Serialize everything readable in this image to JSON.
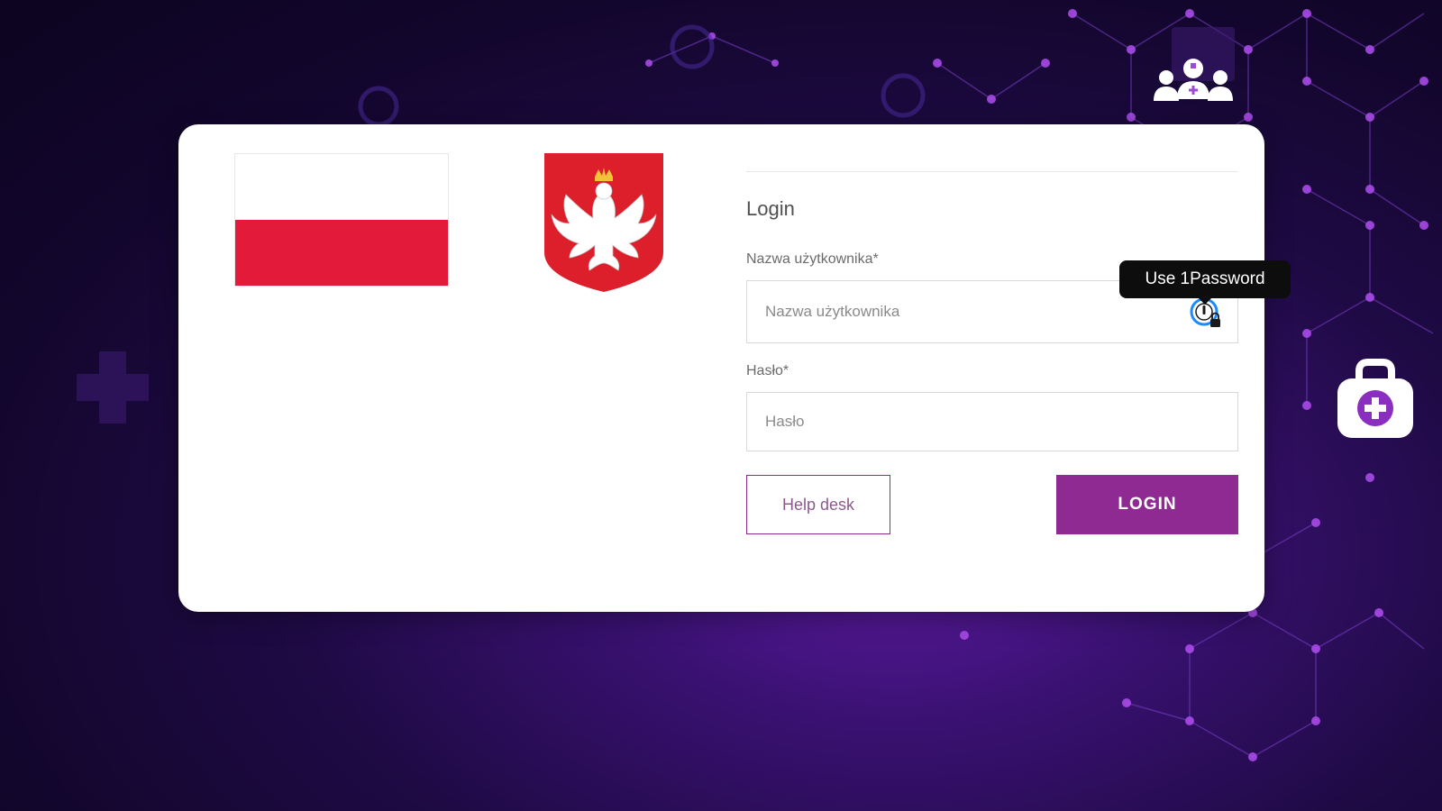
{
  "login": {
    "title": "Login",
    "username_label": "Nazwa użytkownika*",
    "username_placeholder": "Nazwa użytkownika",
    "password_label": "Hasło*",
    "password_placeholder": "Hasło",
    "helpdesk_label": "Help desk",
    "login_label": "LOGIN"
  },
  "tooltip": {
    "text": "Use 1Password"
  },
  "icons": {
    "flag": "poland-flag-icon",
    "emblem": "polish-eagle-emblem-icon",
    "password_manager": "1password-icon",
    "team": "medical-team-icon",
    "medkit": "medical-kit-icon"
  },
  "colors": {
    "accent": "#8f2a93",
    "flag_red": "#e31a3a",
    "background": "#1f0a45"
  }
}
